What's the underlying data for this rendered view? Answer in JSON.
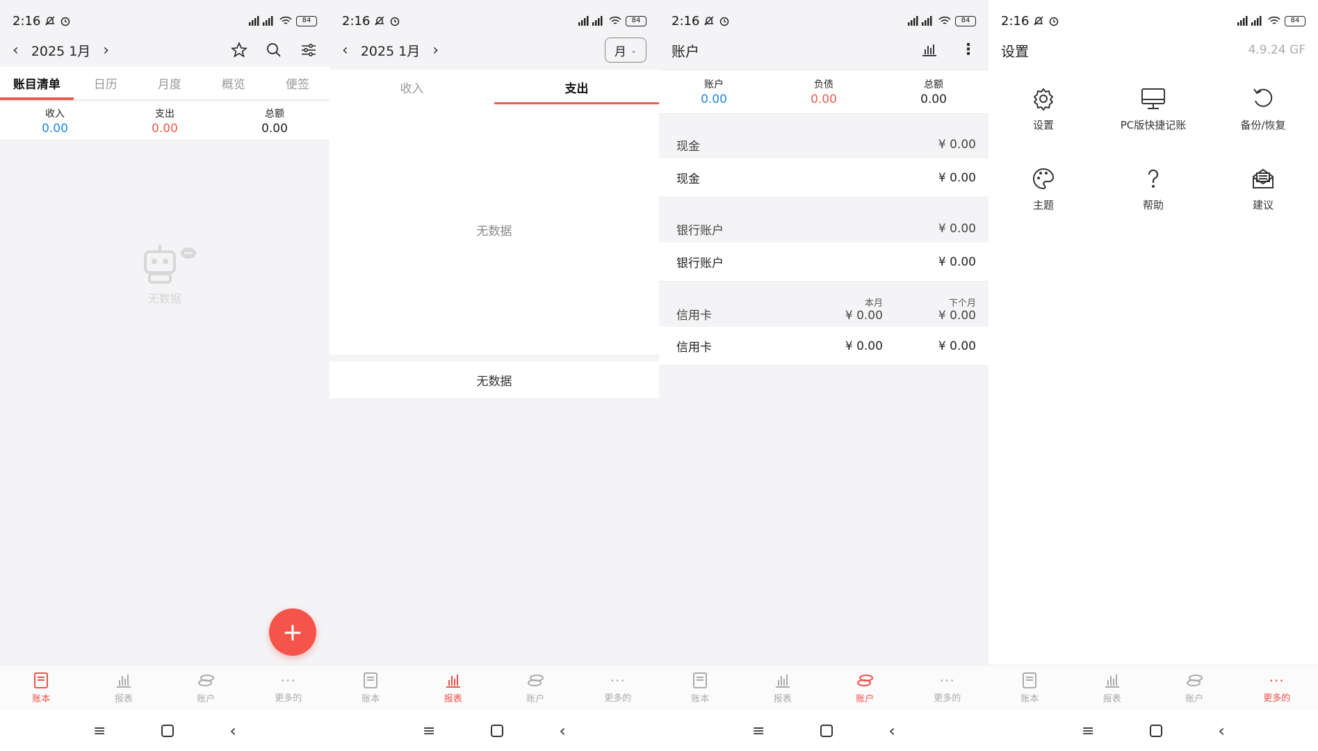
{
  "status": {
    "time": "2:16",
    "battery": "84"
  },
  "bottom_nav": [
    "账本",
    "报表",
    "账户",
    "更多的"
  ],
  "screen1": {
    "month": "2025 1月",
    "tabs": [
      "账目清单",
      "日历",
      "月度",
      "概览",
      "便签"
    ],
    "summary": {
      "income_label": "收入",
      "income": "0.00",
      "expense_label": "支出",
      "expense": "0.00",
      "total_label": "总额",
      "total": "0.00"
    },
    "empty": "无数据",
    "fab": "+"
  },
  "screen2": {
    "month": "2025 1月",
    "period": "月",
    "tabs": [
      "收入",
      "支出"
    ],
    "empty_chart": "无数据",
    "empty_list": "无数据"
  },
  "screen3": {
    "title": "账户",
    "summary": {
      "account_label": "账户",
      "account": "0.00",
      "debt_label": "负债",
      "debt": "0.00",
      "total_label": "总额",
      "total": "0.00"
    },
    "cash_group": "现金",
    "cash_group_amt": "¥ 0.00",
    "cash_item": "现金",
    "cash_item_amt": "¥ 0.00",
    "bank_group": "银行账户",
    "bank_group_amt": "¥ 0.00",
    "bank_item": "银行账户",
    "bank_item_amt": "¥ 0.00",
    "credit_group": "信用卡",
    "this_month_label": "本月",
    "next_month_label": "下个月",
    "credit_group_this": "¥ 0.00",
    "credit_group_next": "¥ 0.00",
    "credit_item": "信用卡",
    "credit_item_this": "¥ 0.00",
    "credit_item_next": "¥ 0.00"
  },
  "screen4": {
    "title": "设置",
    "version": "4.9.24 GF",
    "items": [
      "设置",
      "PC版快捷记账",
      "备份/恢复",
      "主题",
      "帮助",
      "建议"
    ]
  },
  "colors": {
    "accent": "#f0504a",
    "blue": "#1e88e5",
    "red": "#e85e4d"
  }
}
